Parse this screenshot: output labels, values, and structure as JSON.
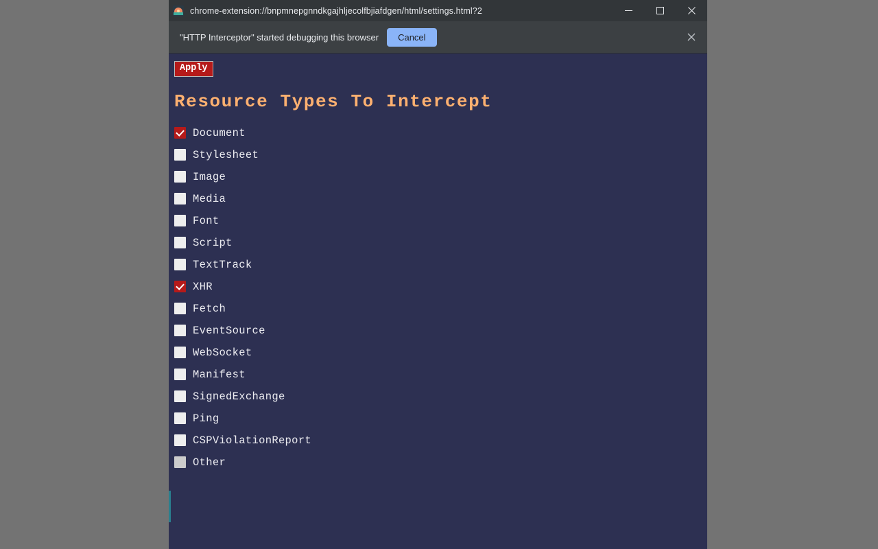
{
  "window": {
    "title": "chrome-extension://bnpmnepgnndkgajhljecolfbjiafdgen/html/settings.html?2",
    "favicon_name": "http-interceptor-favicon",
    "controls": {
      "minimize_label": "Minimize",
      "maximize_label": "Maximize",
      "close_label": "Close"
    }
  },
  "infobar": {
    "message": "\"HTTP Interceptor\" started debugging this browser",
    "cancel_label": "Cancel",
    "close_label": "Close",
    "background_color": "#3c4043",
    "cancel_color": "#8ab4f8"
  },
  "page": {
    "background_color": "#2d3052",
    "apply_label": "Apply",
    "apply_color": "#b51a1a",
    "heading": "Resource Types To Intercept",
    "heading_color": "#fcb070",
    "checked_color": "#b51a1a",
    "unchecked_color": "#eeeeee",
    "hovered_color": "#cccccc",
    "resource_types": [
      {
        "label": "Document",
        "checked": true,
        "hovered": false
      },
      {
        "label": "Stylesheet",
        "checked": false,
        "hovered": false
      },
      {
        "label": "Image",
        "checked": false,
        "hovered": false
      },
      {
        "label": "Media",
        "checked": false,
        "hovered": false
      },
      {
        "label": "Font",
        "checked": false,
        "hovered": false
      },
      {
        "label": "Script",
        "checked": false,
        "hovered": false
      },
      {
        "label": "TextTrack",
        "checked": false,
        "hovered": false
      },
      {
        "label": "XHR",
        "checked": true,
        "hovered": false
      },
      {
        "label": "Fetch",
        "checked": false,
        "hovered": false
      },
      {
        "label": "EventSource",
        "checked": false,
        "hovered": false
      },
      {
        "label": "WebSocket",
        "checked": false,
        "hovered": false
      },
      {
        "label": "Manifest",
        "checked": false,
        "hovered": false
      },
      {
        "label": "SignedExchange",
        "checked": false,
        "hovered": false
      },
      {
        "label": "Ping",
        "checked": false,
        "hovered": false
      },
      {
        "label": "CSPViolationReport",
        "checked": false,
        "hovered": false
      },
      {
        "label": "Other",
        "checked": false,
        "hovered": true
      }
    ]
  },
  "desktop": {
    "background_color": "#737373"
  }
}
